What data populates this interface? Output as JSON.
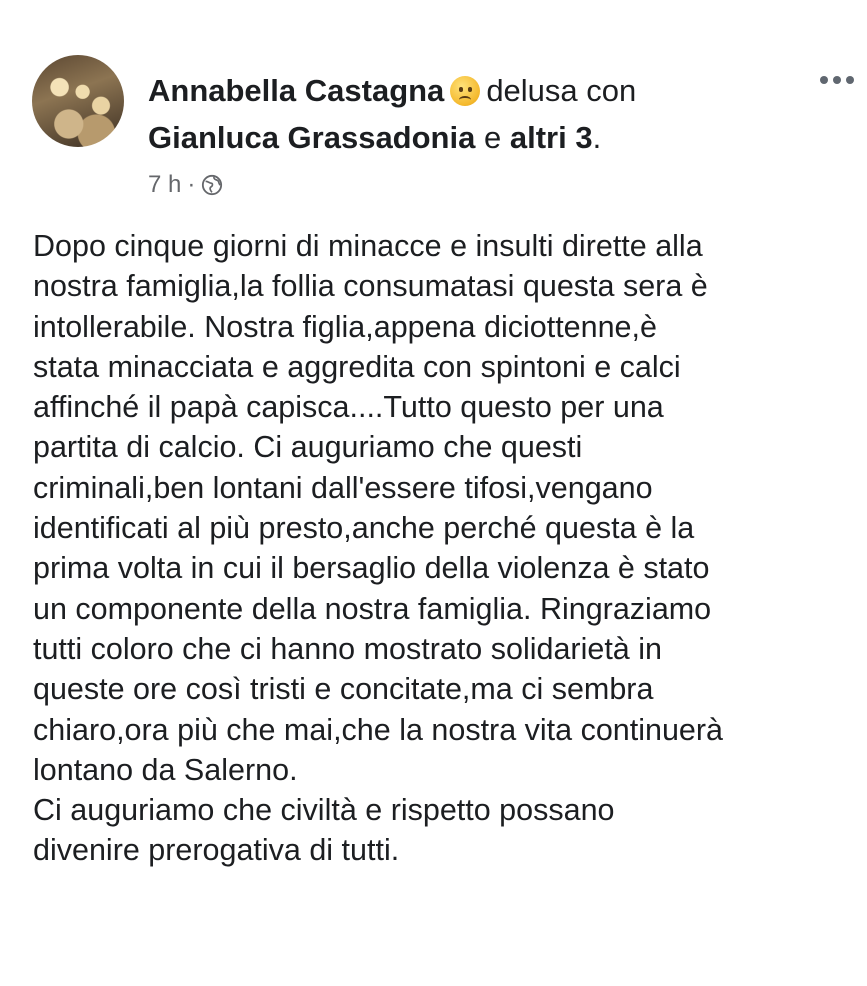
{
  "post": {
    "author": "Annabella Castagna",
    "feeling_icon": "disappointed-face-emoji",
    "feeling": "delusa con",
    "tagged_person": "Gianluca Grassadonia",
    "conjunction": "e",
    "others": "altri 3",
    "period": ".",
    "time": "7 h",
    "separator": "·",
    "audience_icon": "globe-icon",
    "body_lines": [
      "Dopo cinque giorni di minacce e insulti dirette alla",
      "nostra famiglia,la follia consumatasi questa sera è",
      "intollerabile. Nostra figlia,appena diciottenne,è",
      "stata minacciata e aggredita con spintoni e calci",
      "affinché il papà capisca....Tutto questo per una",
      "partita di calcio. Ci auguriamo che questi",
      "criminali,ben lontani dall'essere tifosi,vengano",
      "identificati al più presto,anche perché questa è la",
      "prima volta in cui il bersaglio della violenza è stato",
      "un componente della nostra famiglia. Ringraziamo",
      "tutti coloro che ci hanno mostrato solidarietà in",
      "queste ore così tristi e concitate,ma ci sembra",
      "chiaro,ora più che mai,che la nostra vita continuerà",
      "lontano da Salerno.",
      "Ci auguriamo che civiltà e rispetto possano",
      "divenire prerogativa di tutti."
    ]
  }
}
